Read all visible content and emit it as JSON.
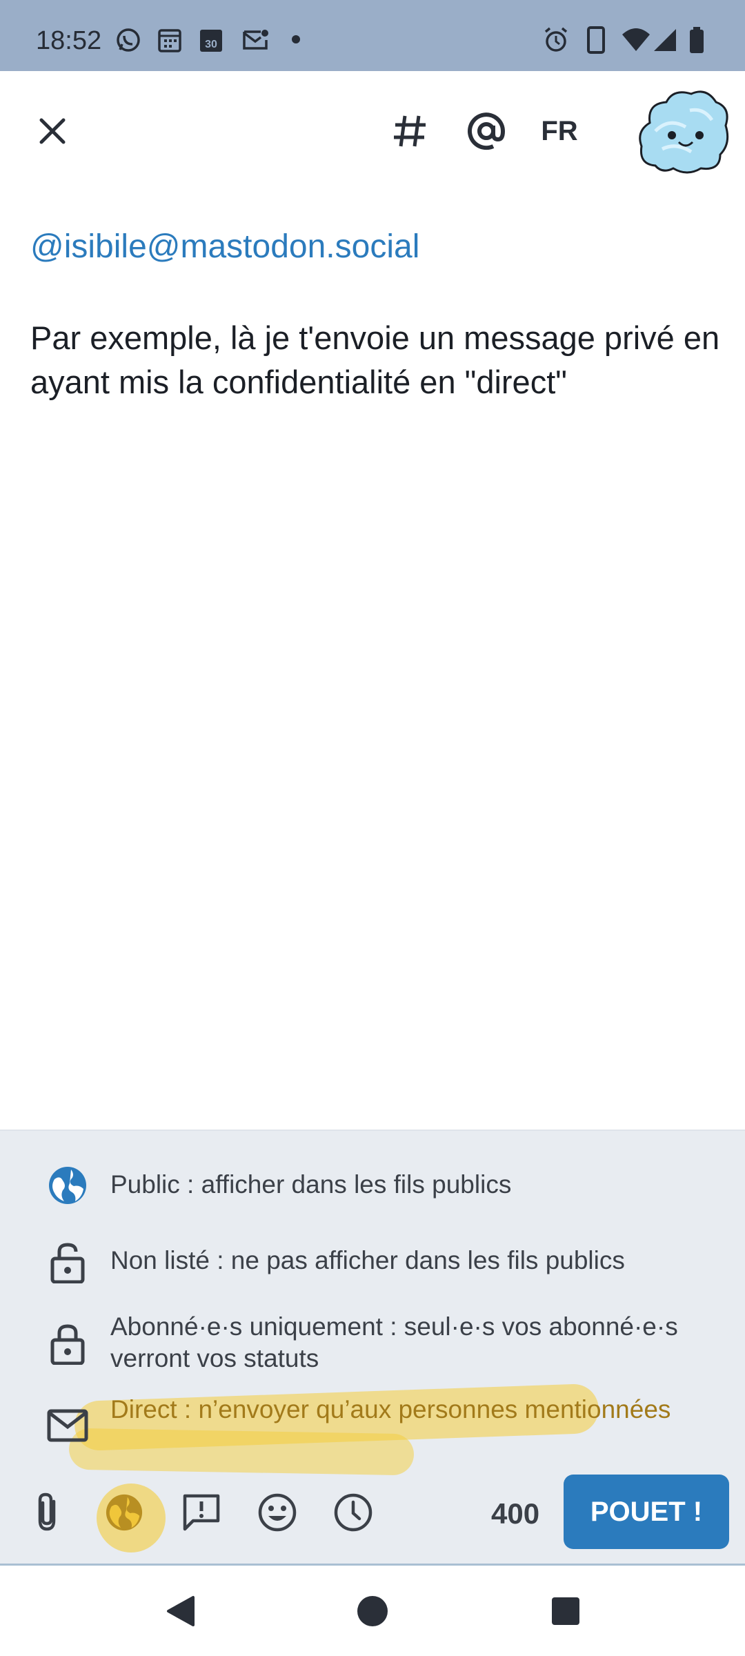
{
  "status_bar": {
    "time": "18:52",
    "calendar_day": "30"
  },
  "header": {
    "language": "FR"
  },
  "compose": {
    "mention": "@isibile@mastodon.social",
    "text": "Par exemple, là je t'envoie un message privé en ayant mis la confidentialité en \"direct\""
  },
  "visibility": {
    "options": [
      {
        "label": "Public : afficher dans les fils publics",
        "icon": "globe-icon"
      },
      {
        "label": "Non listé : ne pas afficher dans les fils publics",
        "icon": "unlock-icon"
      },
      {
        "label": "Abonné·e·s uniquement : seul·e·s vos abonné·e·s verront vos statuts",
        "icon": "lock-icon"
      },
      {
        "label": "Direct : n’envoyer qu’aux personnes mentionnées",
        "icon": "envelope-icon"
      }
    ],
    "selected": "Direct",
    "highlight_color": "#f4cd3c"
  },
  "toolbar": {
    "char_count": "400",
    "submit_label": "POUET !"
  },
  "colors": {
    "accent": "#2b7bbd",
    "status_bar": "#9aaec8",
    "panel": "#e8ecf1"
  }
}
